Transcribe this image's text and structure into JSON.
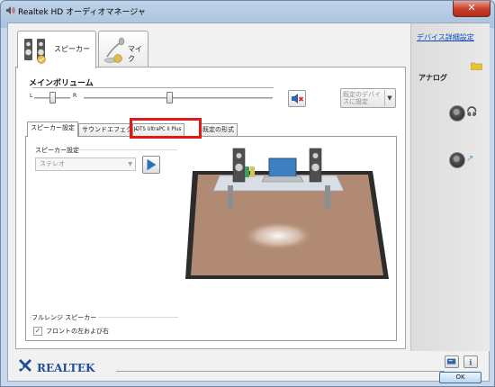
{
  "window": {
    "title": "Realtek HD オーディオマネージャ",
    "close_label": "✕"
  },
  "device_tabs": [
    {
      "label": "スピーカー",
      "icon": "speaker-icon",
      "active": true
    },
    {
      "label": "マイク",
      "icon": "microphone-icon",
      "active": false
    }
  ],
  "volume": {
    "title": "メインボリューム",
    "left_label": "L",
    "right_label": "R",
    "balance": 0.5,
    "level": 0.45
  },
  "default_device": {
    "label": "既定のデバイスに設定"
  },
  "sub_tabs": [
    {
      "label": "スピーカー設定",
      "active": true
    },
    {
      "label": "サウンドエフェクト",
      "active": false
    },
    {
      "label": "DTS UltraPC II Plus",
      "active": false,
      "highlighted": true
    },
    {
      "label": "既定の形式",
      "active": false
    }
  ],
  "speaker_config": {
    "label": "スピーカー設定",
    "value": "ステレオ"
  },
  "full_range": {
    "label": "フルレンジ スピーカー",
    "checkbox_label": "フロントの左および右",
    "checked": true
  },
  "right_pane": {
    "advanced_link": "デバイス詳細設定",
    "analog_label": "アナログ",
    "jacks": [
      "headphone-jack-icon",
      "line-in-jack-icon"
    ]
  },
  "footer": {
    "brand": "REALTEK",
    "ok_label": "OK"
  },
  "colors": {
    "highlight": "#e01818",
    "link": "#0b4bbd",
    "floor": "#b08a72"
  }
}
